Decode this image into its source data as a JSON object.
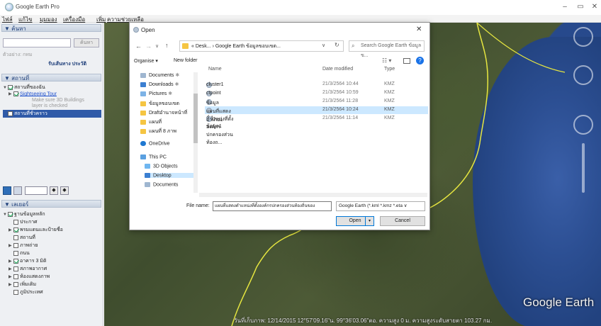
{
  "window": {
    "title": "Google Earth Pro",
    "min": "–",
    "max": "▭",
    "close": "✕"
  },
  "menu": [
    "ไฟล์",
    "แก้ไข",
    "มุมมอง",
    "เครื่องมือ",
    "เพิ่ม",
    "ความช่วยเหลือ"
  ],
  "search": {
    "header": "▼ ค้นหา",
    "button": "ค้นหา",
    "example": "ตัวอย่าง: กทม",
    "links": "รับเส้นทาง  ประวัติ"
  },
  "places": {
    "header": "▼ สถานที่",
    "items": [
      "สถานที่ของฉัน",
      "Sightseeing Tour",
      "Make sure 3D Buildings",
      "layer is checked",
      "สถานที่ชั่วคราว"
    ]
  },
  "layers": {
    "header": "▼ เลเยอร์",
    "items": [
      "ฐานข้อมูลหลัก",
      "ประกาศ",
      "พรมแดนและป้ายชื่อ",
      "สถานที่",
      "ภาพถ่าย",
      "ถนน",
      "อาคาร 3 มิติ",
      "สภาพอากาศ",
      "ห้องแสดงภาพ",
      "เพิ่มเติม",
      "ภูมิประเทศ"
    ]
  },
  "dialog": {
    "title": "Open",
    "close": "✕",
    "path": "«  Desk...  ›  Google Earth ข้อมูลขอบเขต...",
    "search_placeholder": "Search Google Earth ข้อมูลข...",
    "organise": "Organise ▾",
    "new_folder": "New folder",
    "nav": [
      "Documents",
      "Downloads",
      "Pictures",
      "ข้อมูลขอบเขต",
      "Draftอำนาจหน้าที่",
      "แผนที่",
      "แผนที่ 8 ภาพ",
      "OneDrive",
      "This PC",
      "3D Objects",
      "Desktop",
      "Documents"
    ],
    "columns": {
      "name": "Name",
      "date": "Date modified",
      "type": "Type"
    },
    "files": [
      {
        "name": "cluster1",
        "date": "21/3/2564 10:44",
        "type": "KMZ"
      },
      {
        "name": "ctpoint",
        "date": "21/3/2564 10:59",
        "type": "KMZ"
      },
      {
        "name": "ข้อมูลสถานที่ทำข้อมูล1",
        "date": "21/3/2564 11:28",
        "type": "KMZ"
      },
      {
        "name": "แผนที่แสดงตำแหน่งที่ตั้งองค์กรปกครองส่วนท้องถ...",
        "date": "21/3/2564 10:24",
        "type": "KMZ"
      },
      {
        "name": "อำเภอ1",
        "date": "21/3/2564 11:14",
        "type": "KMZ"
      }
    ],
    "filename_label": "File name:",
    "filename_value": "แผนที่แสดงตำแหน่งที่ตั้งองค์กรปกครองส่วนท้องถิ่นของ",
    "filter": "Google Earth (*.kml *.kmz *.eta ∨",
    "open": "Open",
    "cancel": "Cancel"
  },
  "status": "วันที่เก็บภาพ: 12/14/2015    12°57'09.16\"น.  99°36'03.06\"ตอ.  ความสูง     0 ม.     ความสูงระดับสายตา 103.27 กม.",
  "logo": "Google Earth",
  "colors": {
    "sea": "#2c4f93",
    "border_line": "#e6e640",
    "selection": "#cce8ff"
  }
}
